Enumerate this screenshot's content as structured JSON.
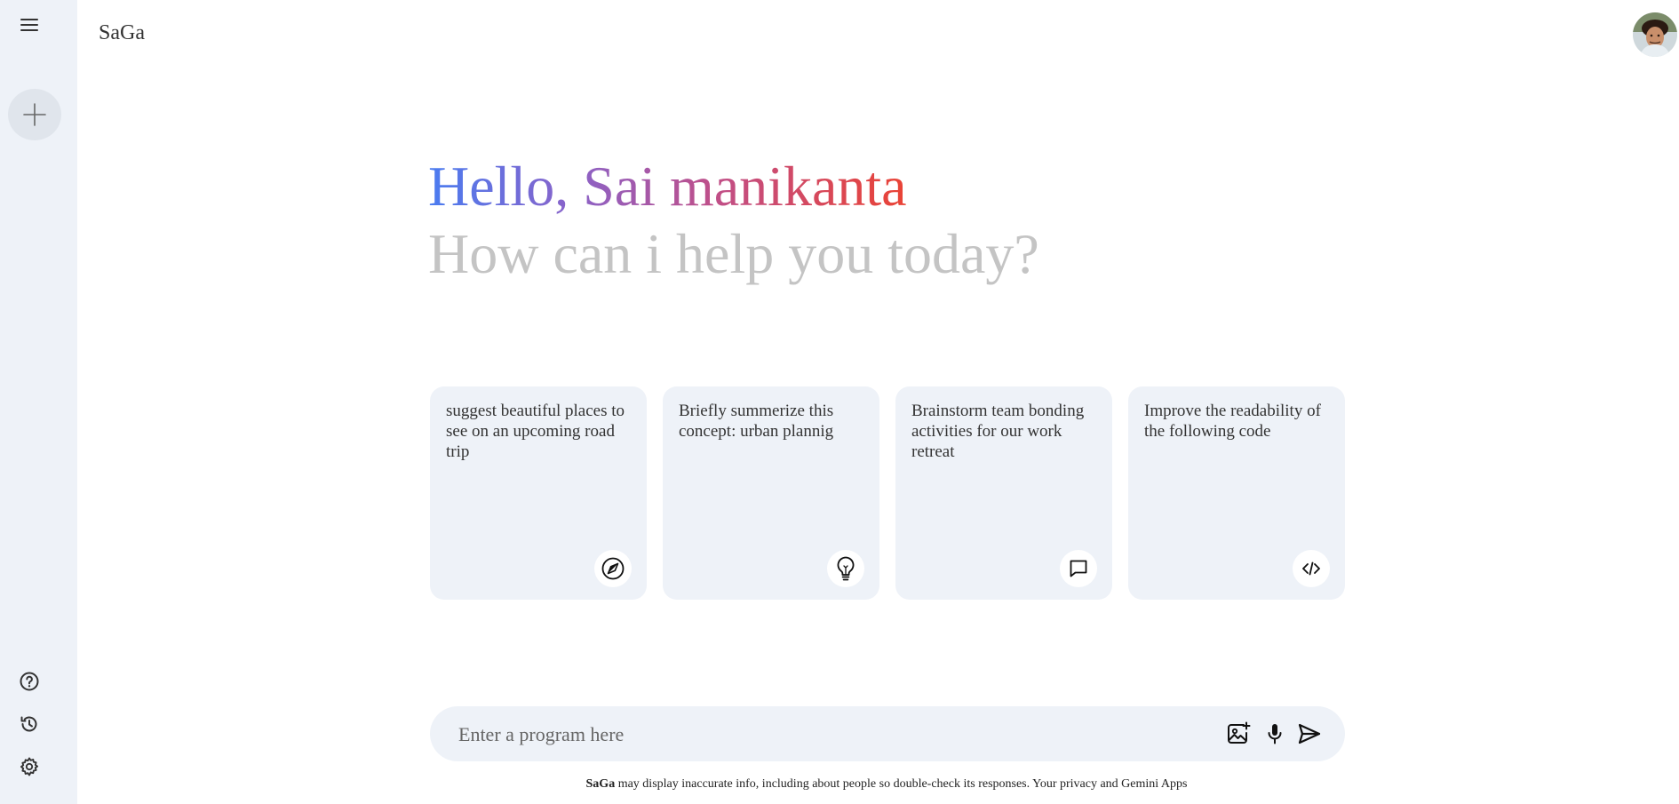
{
  "app": {
    "brand": "SaGa"
  },
  "sidebar": {
    "icons": {
      "menu": "menu-icon",
      "new_chat": "plus-icon",
      "help": "help-icon",
      "history": "history-icon",
      "settings": "settings-icon"
    }
  },
  "greeting": {
    "hello": "Hello, Sai manikanta",
    "subtitle": "How can i help you today?"
  },
  "cards": [
    {
      "text": "suggest beautiful places to see on an upcoming road trip",
      "icon": "compass-icon"
    },
    {
      "text": "Briefly summerize this concept: urban plannig",
      "icon": "lightbulb-icon"
    },
    {
      "text": "Brainstorm team bonding activities for our work retreat",
      "icon": "chat-icon"
    },
    {
      "text": "Improve the readability of the following code",
      "icon": "code-icon"
    }
  ],
  "prompt": {
    "placeholder": "Enter a program here",
    "value": ""
  },
  "footer": {
    "brand": "SaGa",
    "text": " may display inaccurate info, including about people so double-check its responses. Your privacy and Gemini Apps"
  },
  "colors": {
    "sidebar_bg": "#eef2f8",
    "card_bg": "#eef2f8",
    "gradient_start": "#4a7cf0",
    "gradient_end": "#ea4335",
    "subtitle": "#c4c4c4"
  }
}
